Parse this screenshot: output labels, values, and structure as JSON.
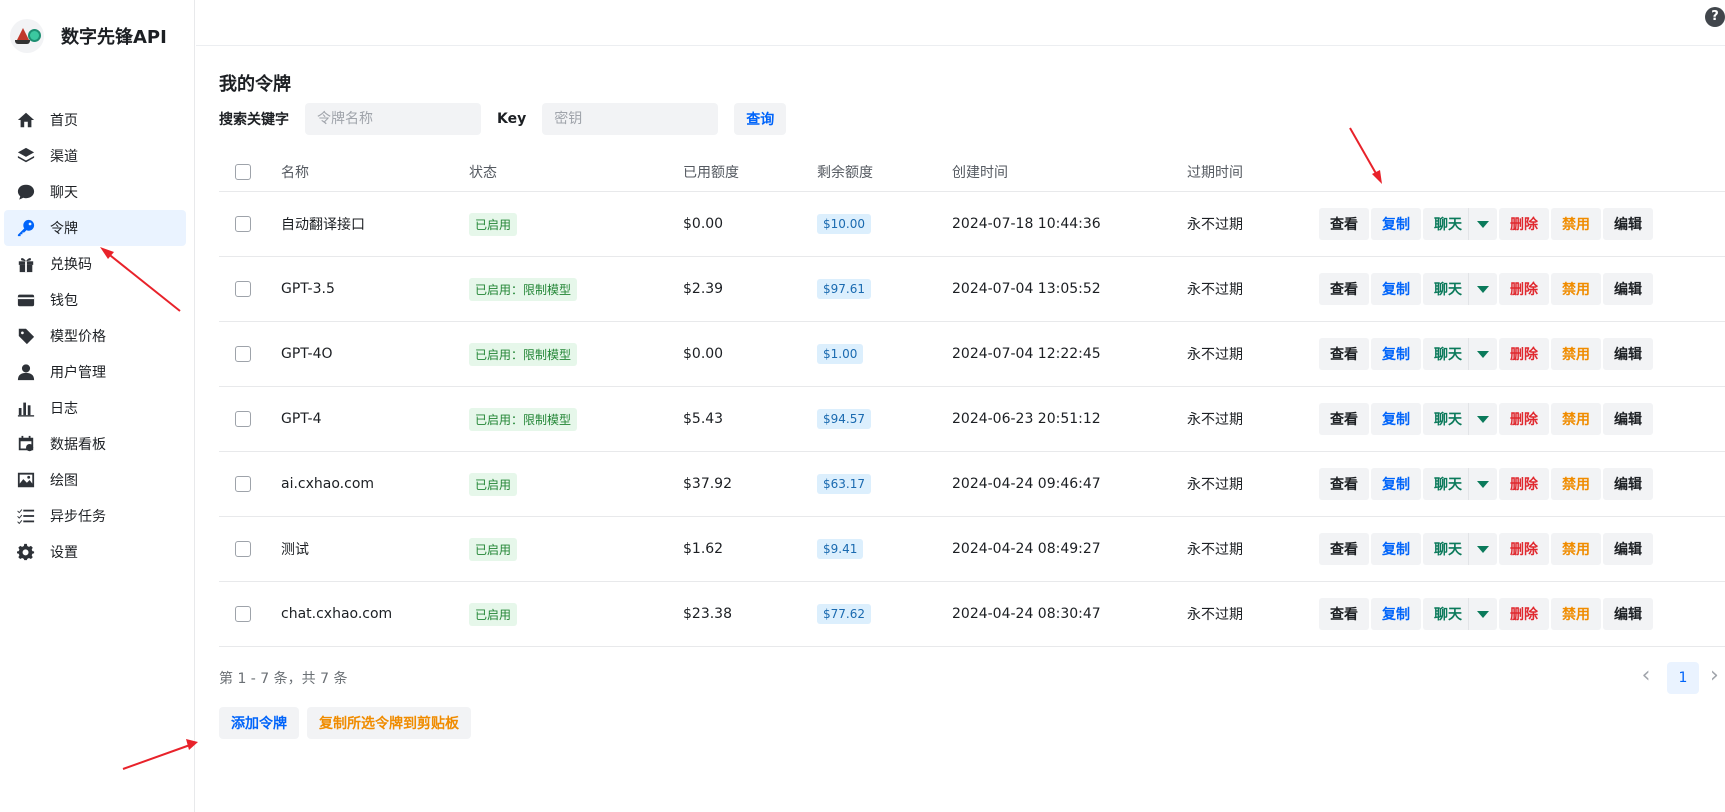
{
  "app": {
    "title": "数字先锋API"
  },
  "colors": {
    "accent": "#0064fa",
    "danger": "#e0282e",
    "warning": "#f08c00",
    "success": "#238636",
    "annotation_arrow": "#e8222a"
  },
  "sidebar": {
    "items": [
      {
        "label": "首页",
        "icon": "home-icon",
        "active": false
      },
      {
        "label": "渠道",
        "icon": "layers-icon",
        "active": false
      },
      {
        "label": "聊天",
        "icon": "chat-bubble-icon",
        "active": false
      },
      {
        "label": "令牌",
        "icon": "key-icon",
        "active": true
      },
      {
        "label": "兑换码",
        "icon": "gift-icon",
        "active": false
      },
      {
        "label": "钱包",
        "icon": "wallet-icon",
        "active": false
      },
      {
        "label": "模型价格",
        "icon": "price-tag-icon",
        "active": false
      },
      {
        "label": "用户管理",
        "icon": "user-icon",
        "active": false
      },
      {
        "label": "日志",
        "icon": "bar-chart-icon",
        "active": false
      },
      {
        "label": "数据看板",
        "icon": "calendar-icon",
        "active": false
      },
      {
        "label": "绘图",
        "icon": "image-icon",
        "active": false
      },
      {
        "label": "异步任务",
        "icon": "task-list-icon",
        "active": false
      },
      {
        "label": "设置",
        "icon": "gear-icon",
        "active": false
      }
    ]
  },
  "header": {
    "help_icon": "?"
  },
  "main": {
    "title": "我的令牌",
    "search": {
      "keyword_label": "搜索关键字",
      "name_placeholder": "令牌名称",
      "key_label": "Key",
      "key_placeholder": "密钥",
      "query_button": "查询"
    }
  },
  "table": {
    "columns": [
      "名称",
      "状态",
      "已用额度",
      "剩余额度",
      "创建时间",
      "过期时间"
    ],
    "action_labels": {
      "view": "查看",
      "copy": "复制",
      "chat": "聊天",
      "delete": "删除",
      "disable": "禁用",
      "edit": "编辑"
    },
    "rows": [
      {
        "name": "自动翻译接口",
        "status": "已启用",
        "used": "$0.00",
        "remaining": "$10.00",
        "created": "2024-07-18 10:44:36",
        "expires": "永不过期"
      },
      {
        "name": "GPT-3.5",
        "status": "已启用：限制模型",
        "used": "$2.39",
        "remaining": "$97.61",
        "created": "2024-07-04 13:05:52",
        "expires": "永不过期"
      },
      {
        "name": "GPT-4O",
        "status": "已启用：限制模型",
        "used": "$0.00",
        "remaining": "$1.00",
        "created": "2024-07-04 12:22:45",
        "expires": "永不过期"
      },
      {
        "name": "GPT-4",
        "status": "已启用：限制模型",
        "used": "$5.43",
        "remaining": "$94.57",
        "created": "2024-06-23 20:51:12",
        "expires": "永不过期"
      },
      {
        "name": "ai.cxhao.com",
        "status": "已启用",
        "used": "$37.92",
        "remaining": "$63.17",
        "created": "2024-04-24 09:46:47",
        "expires": "永不过期"
      },
      {
        "name": "测试",
        "status": "已启用",
        "used": "$1.62",
        "remaining": "$9.41",
        "created": "2024-04-24 08:49:27",
        "expires": "永不过期"
      },
      {
        "name": "chat.cxhao.com",
        "status": "已启用",
        "used": "$23.38",
        "remaining": "$77.62",
        "created": "2024-04-24 08:30:47",
        "expires": "永不过期"
      }
    ]
  },
  "footer": {
    "summary": "第 1 - 7 条，共 7 条",
    "current_page": "1",
    "add_button": "添加令牌",
    "copy_selected_button": "复制所选令牌到剪贴板"
  }
}
